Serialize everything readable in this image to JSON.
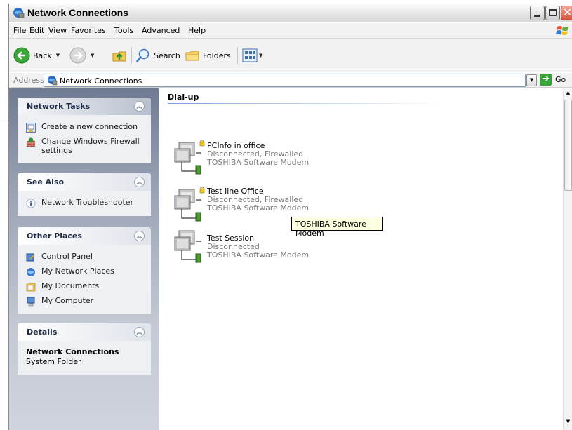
{
  "window": {
    "title": "Network Connections",
    "icon": "network-connections-icon"
  },
  "menu": [
    {
      "label": "File",
      "mnemonic": "F"
    },
    {
      "label": "Edit",
      "mnemonic": "E"
    },
    {
      "label": "View",
      "mnemonic": "V"
    },
    {
      "label": "Favorites",
      "mnemonic": "a"
    },
    {
      "label": "Tools",
      "mnemonic": "T"
    },
    {
      "label": "Advanced",
      "mnemonic": "n"
    },
    {
      "label": "Help",
      "mnemonic": "H"
    }
  ],
  "toolbar": {
    "back_label": "Back",
    "search_label": "Search",
    "folders_label": "Folders"
  },
  "address": {
    "label": "Address",
    "value": "Network Connections",
    "go_label": "Go"
  },
  "sidebar": {
    "network_tasks": {
      "title": "Network Tasks",
      "items": [
        {
          "label": "Create a new connection",
          "icon": "new-connection-icon"
        },
        {
          "label": "Change Windows Firewall settings",
          "icon": "firewall-icon"
        }
      ]
    },
    "see_also": {
      "title": "See Also",
      "items": [
        {
          "label": "Network Troubleshooter",
          "icon": "info-icon"
        }
      ]
    },
    "other_places": {
      "title": "Other Places",
      "items": [
        {
          "label": "Control Panel",
          "icon": "control-panel-icon"
        },
        {
          "label": "My Network Places",
          "icon": "network-places-icon"
        },
        {
          "label": "My Documents",
          "icon": "documents-folder-icon"
        },
        {
          "label": "My Computer",
          "icon": "computer-icon"
        }
      ]
    },
    "details": {
      "title": "Details",
      "name": "Network Connections",
      "type": "System Folder"
    }
  },
  "content": {
    "group_title": "Dial-up",
    "connections": [
      {
        "name": "PCInfo in office",
        "status": "Disconnected, Firewalled",
        "device": "TOSHIBA Software Modem"
      },
      {
        "name": "Test line Office",
        "status": "Disconnected, Firewalled",
        "device": "TOSHIBA Software Modem"
      },
      {
        "name": "Test Session",
        "status": "Disconnected",
        "device": "TOSHIBA Software Modem"
      }
    ],
    "tooltip": "TOSHIBA Software Modem"
  },
  "colors": {
    "taskpane_gradient_top": "#6e7b92",
    "panel_bg": "#eef0f4",
    "accent_green": "#38a33a",
    "tooltip_bg": "#ffffe1"
  }
}
